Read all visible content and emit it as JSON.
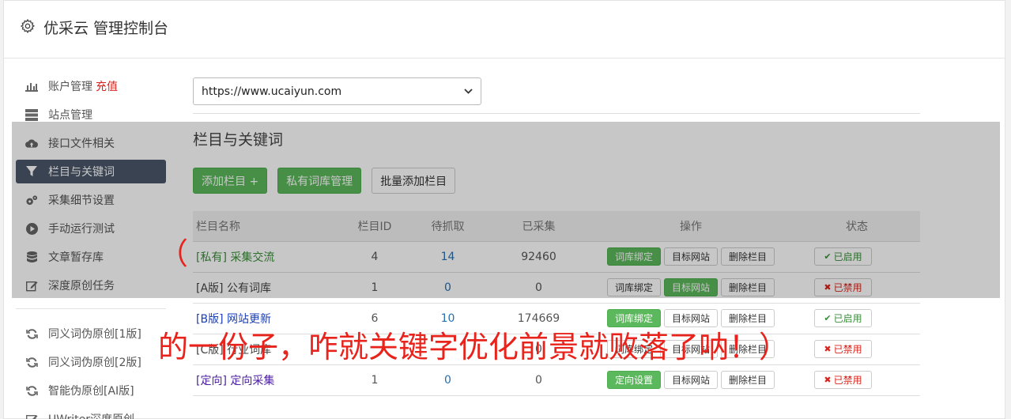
{
  "header": {
    "title": "优采云 管理控制台",
    "icon": "gear-icon"
  },
  "sidebar": {
    "items": [
      {
        "label": "账户管理",
        "badge": "充值",
        "icon": "bar-chart-icon"
      },
      {
        "label": "站点管理",
        "icon": "server-icon"
      },
      {
        "label": "接口文件相关",
        "icon": "cloud-upload-icon"
      },
      {
        "label": "栏目与关键词",
        "icon": "filter-icon",
        "active": true
      },
      {
        "label": "采集细节设置",
        "icon": "cogs-icon"
      },
      {
        "label": "手动运行测试",
        "icon": "play-circle-icon"
      },
      {
        "label": "文章暂存库",
        "icon": "database-icon"
      },
      {
        "label": "深度原创任务",
        "icon": "edit-icon"
      }
    ],
    "items2": [
      {
        "label": "同义词伪原创[1版]",
        "icon": "refresh-icon"
      },
      {
        "label": "同义词伪原创[2版]",
        "icon": "refresh-icon"
      },
      {
        "label": "智能伪原创[AI版]",
        "icon": "refresh-icon"
      },
      {
        "label": "UWriter深度原创",
        "icon": "edit-icon"
      }
    ]
  },
  "main": {
    "site_select": "https://www.ucaiyun.com",
    "section_title": "栏目与关键词",
    "buttons": {
      "add": "添加栏目 +",
      "private": "私有词库管理",
      "batch": "批量添加栏目"
    },
    "table": {
      "headers": [
        "栏目名称",
        "栏目ID",
        "待抓取",
        "已采集",
        "操作",
        "状态"
      ],
      "rows": [
        {
          "name": "[私有] 采集交流",
          "id": "4",
          "pending": "14",
          "collected": "92460",
          "op1": "词库绑定",
          "op2": "目标网站",
          "op3": "删除栏目",
          "status": "已启用"
        },
        {
          "name": "[A版] 公有词库",
          "id": "1",
          "pending": "0",
          "collected": "0",
          "op1": "词库绑定",
          "op2": "目标网站",
          "op3": "删除栏目",
          "status": "已禁用"
        },
        {
          "name": "[B版] 网站更新",
          "id": "6",
          "pending": "10",
          "collected": "174669",
          "op1": "词库绑定",
          "op2": "目标网站",
          "op3": "删除栏目",
          "status": "已启用"
        },
        {
          "name": "[C版] 行业词库",
          "id": "",
          "pending": "",
          "collected": "0",
          "op1": "词库绑定",
          "op2": "目标网站",
          "op3": "删除栏目",
          "status": "已禁用"
        },
        {
          "name": "[定向] 定向采集",
          "id": "1",
          "pending": "0",
          "collected": "0",
          "op1": "定向设置",
          "op2": "目标网站",
          "op3": "删除栏目",
          "status": "已禁用"
        }
      ]
    }
  },
  "overlay_caption": {
    "paren": "（",
    "text": "的一份子，咋就关键字优化前景就败落了呐！）"
  },
  "colors": {
    "accent_green": "#5cb85c",
    "sidebar_active": "#4a5668",
    "danger": "#d9241b",
    "caption_red": "#e8231c"
  }
}
